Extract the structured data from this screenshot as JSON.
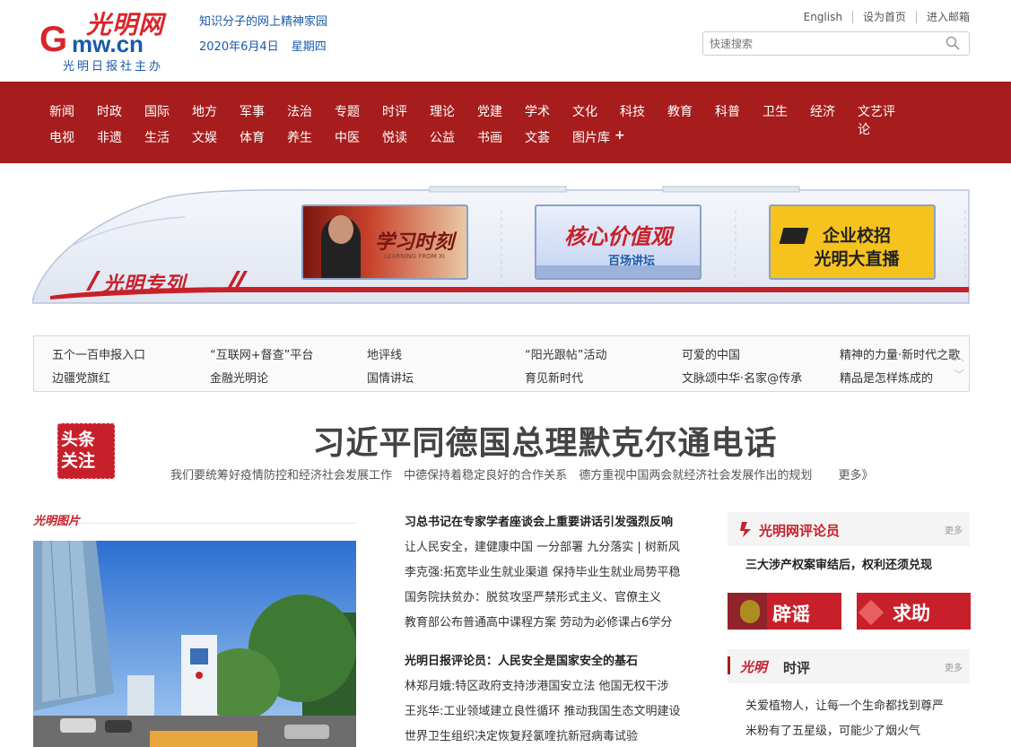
{
  "header": {
    "logo_cn": "光明网",
    "logo_domain": "mw.cn",
    "logo_g": "G",
    "logo_sub": "光明日报社主办",
    "slogan": "知识分子的网上精神家园",
    "date": "2020年6月4日",
    "weekday": "星期四",
    "links": [
      "English",
      "设为首页",
      "进入邮箱"
    ],
    "search_placeholder": "快速搜索"
  },
  "nav": {
    "row1": [
      "新闻",
      "时政",
      "国际",
      "地方",
      "军事",
      "法治",
      "专题",
      "时评",
      "理论",
      "党建",
      "学术",
      "文化",
      "科技",
      "教育",
      "科普",
      "卫生",
      "经济",
      "文艺评论"
    ],
    "row2": [
      "电视",
      "非遗",
      "生活",
      "文娱",
      "体育",
      "养生",
      "中医",
      "悦读",
      "公益",
      "书画",
      "文荟",
      "图片库"
    ],
    "plus": "+"
  },
  "banner": {
    "train_label": "光明专列",
    "tile1": "学习时刻",
    "tile1_sub": "LEARNING FROM XI",
    "tile2": "核心价值观",
    "tile2_sub": "百场讲坛",
    "tile3_line1": "企业校招",
    "tile3_line2": "光明大直播"
  },
  "links_box": {
    "row1": [
      "五个一百申报入口",
      "“互联网+督查”平台",
      "地评线",
      "“阳光跟帖”活动",
      "可爱的中国",
      "精神的力量·新时代之歌"
    ],
    "row2": [
      "边疆党旗红",
      "金融光明论",
      "国情讲坛",
      "育见新时代",
      "文脉颂中华·名家@传承",
      "精品是怎样炼成的"
    ]
  },
  "headline": {
    "stamp": "头条关注",
    "title": "习近平同德国总理默克尔通电话",
    "subs": [
      "我们要统筹好疫情防控和经济社会发展工作",
      "中德保持着稳定良好的合作关系",
      "德方重视中国两会就经济社会发展作出的规划"
    ],
    "more": "更多》"
  },
  "photo_section": {
    "label": "光明图片"
  },
  "news": {
    "group1": [
      "习总书记在专家学者座谈会上重要讲话引发强烈反响",
      "让人民安全，建健康中国 一分部署 九分落实 | 树新风",
      "李克强:拓宽毕业生就业渠道 保持毕业生就业局势平稳",
      "国务院扶贫办：脱贫攻坚严禁形式主义、官僚主义",
      "教育部公布普通高中课程方案 劳动为必修课占6学分"
    ],
    "group2": [
      "光明日报评论员：人民安全是国家安全的基石",
      "林郑月娥:特区政府支持涉港国安立法 他国无权干涉",
      "王兆华:工业领域建立良性循环 推动我国生态文明建设",
      "世界卫生组织决定恢复羟氯喹抗新冠病毒试验"
    ]
  },
  "right": {
    "commentator_title": "光明网评论员",
    "commentator_more": "更多",
    "commentator_headline": "三大涉产权案审结后，权利还须兑现",
    "rumor": "辟谣",
    "help": "求助",
    "comment_title": "时评",
    "comment_more": "更多",
    "comment_items": [
      "关爱植物人，让每一个生命都找到尊严",
      "米粉有了五星级，可能少了烟火气"
    ]
  },
  "colors": {
    "brand_red": "#a71d1d",
    "logo_blue": "#1a5aa8"
  }
}
